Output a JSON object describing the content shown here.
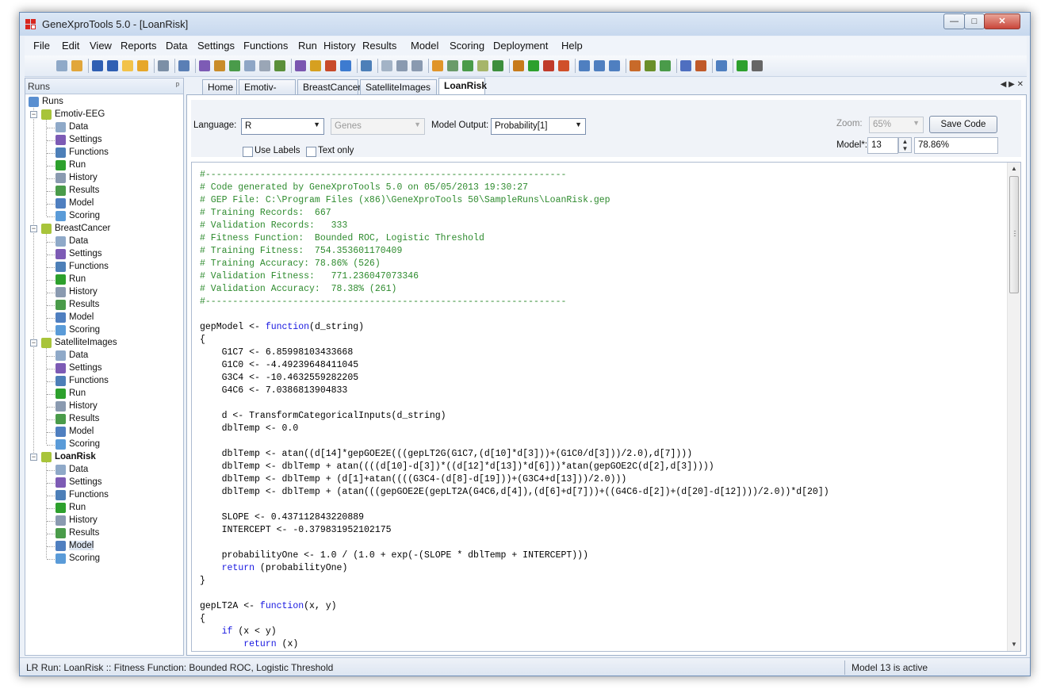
{
  "window": {
    "title": "GeneXproTools 5.0 - [LoanRisk]",
    "controls": {
      "minimize": "—",
      "maximize": "□",
      "close": "✕"
    }
  },
  "menu": [
    "File",
    "Edit",
    "View",
    "Reports",
    "Data",
    "Settings",
    "Functions",
    "Run",
    "History",
    "Results",
    "Model",
    "Scoring",
    "Deployment",
    "Help"
  ],
  "left_panel": {
    "title": "Runs",
    "pin": "ᵖ",
    "root": "Runs",
    "runs": [
      {
        "name": "Emotiv-EEG",
        "bold": false,
        "children": [
          "Data",
          "Settings",
          "Functions",
          "Run",
          "History",
          "Results",
          "Model",
          "Scoring"
        ]
      },
      {
        "name": "BreastCancer",
        "bold": false,
        "children": [
          "Data",
          "Settings",
          "Functions",
          "Run",
          "History",
          "Results",
          "Model",
          "Scoring"
        ]
      },
      {
        "name": "SatelliteImages",
        "bold": false,
        "children": [
          "Data",
          "Settings",
          "Functions",
          "Run",
          "History",
          "Results",
          "Model",
          "Scoring"
        ]
      },
      {
        "name": "LoanRisk",
        "bold": true,
        "children": [
          "Data",
          "Settings",
          "Functions",
          "Run",
          "History",
          "Results",
          "Model",
          "Scoring"
        ]
      }
    ]
  },
  "tabs": {
    "items": [
      "Home",
      "Emotiv-EEG",
      "BreastCancer",
      "SatelliteImages",
      "LoanRisk"
    ],
    "active": "LoanRisk",
    "nav": "◀ ▶ ✕"
  },
  "controls": {
    "language_label": "Language:",
    "language_value": "R",
    "genes_value": "Genes",
    "model_output_label": "Model Output:",
    "model_output_value": "Probability[1]",
    "use_labels": "Use Labels",
    "text_only": "Text only",
    "zoom_label": "Zoom:",
    "zoom_value": "65%",
    "save_code": "Save Code",
    "model_label": "Model*:",
    "model_number": "13",
    "model_accuracy": "78.86%"
  },
  "code": {
    "lines": [
      [
        {
          "t": "#------------------------------------------------------------------",
          "c": "comment"
        }
      ],
      [
        {
          "t": "# Code generated by GeneXproTools 5.0 on 05/05/2013 19:30:27",
          "c": "comment"
        }
      ],
      [
        {
          "t": "# GEP File: C:\\Program Files (x86)\\GeneXproTools 50\\SampleRuns\\LoanRisk.gep",
          "c": "comment"
        }
      ],
      [
        {
          "t": "# Training Records:  667",
          "c": "comment"
        }
      ],
      [
        {
          "t": "# Validation Records:   333",
          "c": "comment"
        }
      ],
      [
        {
          "t": "# Fitness Function:  Bounded ROC, Logistic Threshold",
          "c": "comment"
        }
      ],
      [
        {
          "t": "# Training Fitness:  754.353601170409",
          "c": "comment"
        }
      ],
      [
        {
          "t": "# Training Accuracy: 78.86% (526)",
          "c": "comment"
        }
      ],
      [
        {
          "t": "# Validation Fitness:   771.236047073346",
          "c": "comment"
        }
      ],
      [
        {
          "t": "# Validation Accuracy:  78.38% (261)",
          "c": "comment"
        }
      ],
      [
        {
          "t": "#------------------------------------------------------------------",
          "c": "comment"
        }
      ],
      [],
      [
        {
          "t": "gepModel <- ",
          "c": "plain"
        },
        {
          "t": "function",
          "c": "kw"
        },
        {
          "t": "(d_string)",
          "c": "plain"
        }
      ],
      [
        {
          "t": "{",
          "c": "plain"
        }
      ],
      [
        {
          "t": "    G1C7 <- 6.85998103433668",
          "c": "plain"
        }
      ],
      [
        {
          "t": "    G1C0 <- -4.49239648411045",
          "c": "plain"
        }
      ],
      [
        {
          "t": "    G3C4 <- -10.4632559282205",
          "c": "plain"
        }
      ],
      [
        {
          "t": "    G4C6 <- 7.0386813904833",
          "c": "plain"
        }
      ],
      [],
      [
        {
          "t": "    d <- TransformCategoricalInputs(d_string)",
          "c": "plain"
        }
      ],
      [
        {
          "t": "    dblTemp <- 0.0",
          "c": "plain"
        }
      ],
      [],
      [
        {
          "t": "    dblTemp <- atan((d[14]*gepGOE2E(((gepLT2G(G1C7,(d[10]*d[3]))+(G1C0/d[3]))/2.0),d[7])))",
          "c": "plain"
        }
      ],
      [
        {
          "t": "    dblTemp <- dblTemp + atan((((d[10]-d[3])*((d[12]*d[13])*d[6]))*atan(gepGOE2C(d[2],d[3]))))",
          "c": "plain"
        }
      ],
      [
        {
          "t": "    dblTemp <- dblTemp + (d[1]+atan((((G3C4-(d[8]-d[19]))+(G3C4+d[13]))/2.0)))",
          "c": "plain"
        }
      ],
      [
        {
          "t": "    dblTemp <- dblTemp + (atan(((gepGOE2E(gepLT2A(G4C6,d[4]),(d[6]+d[7]))+((G4C6-d[2])+(d[20]-d[12])))/2.0))*d[20])",
          "c": "plain"
        }
      ],
      [],
      [
        {
          "t": "    SLOPE <- 0.437112843220889",
          "c": "plain"
        }
      ],
      [
        {
          "t": "    INTERCEPT <- -0.379831952102175",
          "c": "plain"
        }
      ],
      [],
      [
        {
          "t": "    probabilityOne <- 1.0 / (1.0 + exp(-(SLOPE * dblTemp + INTERCEPT)))",
          "c": "plain"
        }
      ],
      [
        {
          "t": "    ",
          "c": "plain"
        },
        {
          "t": "return",
          "c": "kw"
        },
        {
          "t": " (probabilityOne)",
          "c": "plain"
        }
      ],
      [
        {
          "t": "}",
          "c": "plain"
        }
      ],
      [],
      [
        {
          "t": "gepLT2A <- ",
          "c": "plain"
        },
        {
          "t": "function",
          "c": "kw"
        },
        {
          "t": "(x, y)",
          "c": "plain"
        }
      ],
      [
        {
          "t": "{",
          "c": "plain"
        }
      ],
      [
        {
          "t": "    ",
          "c": "plain"
        },
        {
          "t": "if",
          "c": "kw"
        },
        {
          "t": " (x < y)",
          "c": "plain"
        }
      ],
      [
        {
          "t": "        ",
          "c": "plain"
        },
        {
          "t": "return",
          "c": "kw"
        },
        {
          "t": " (x)",
          "c": "plain"
        }
      ]
    ]
  },
  "status": {
    "left": "LR Run: LoanRisk :: Fitness Function: Bounded ROC, Logistic Threshold",
    "right": "Model 13 is active"
  },
  "colors": {
    "comment": "#2e8b2e",
    "keyword": "#1818e0",
    "window_border": "#6b8cb5"
  }
}
